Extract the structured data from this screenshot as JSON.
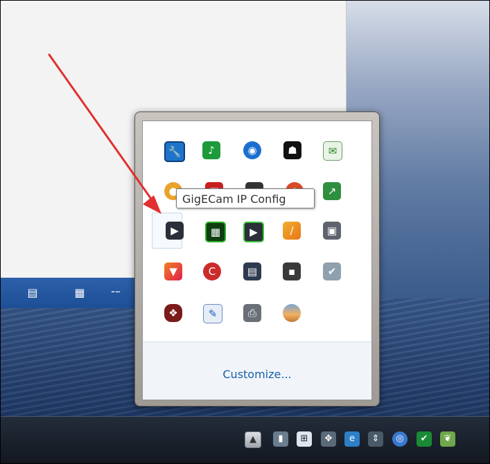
{
  "tooltip": {
    "text": "GigECam IP Config"
  },
  "popup": {
    "customize_label": "Customize..."
  },
  "tray_grid": [
    [
      "wrench-icon",
      "green-app-icon",
      "globe-icon",
      "black-cat-icon",
      "mail-download-icon"
    ],
    [
      "palette-icon",
      "red-app-icon",
      "monitor-icon",
      "orange-app-icon",
      "green-chart-icon"
    ],
    [
      "camera-config-icon",
      "green-grid-icon",
      "green-camera-icon",
      "orange-stroke-icon",
      "drive-icon"
    ],
    [
      "funnel-icon",
      "ccleaner-icon",
      "printer-monitor-icon",
      "dark-app-icon",
      "disk-check-icon"
    ],
    [
      "figures-icon",
      "notepad-icon",
      "printer-error-icon",
      "sunset-icon"
    ]
  ],
  "taskbar_icons": [
    "show-hidden-icons-button",
    "battery-check-icon",
    "windows-icon",
    "dropbox-icon",
    "sync-icon",
    "arrows-icon",
    "compass-icon",
    "shield-icon"
  ],
  "colors": {
    "link": "#1a5ea8",
    "arrow": "#e03030",
    "statusbar": "#2c60a8"
  }
}
